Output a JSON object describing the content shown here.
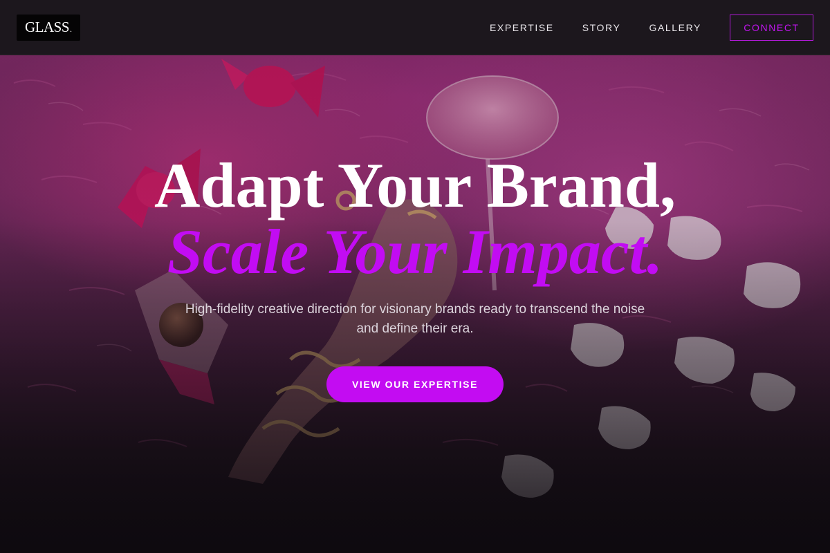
{
  "brand": {
    "logo_text": "GLASS",
    "logo_dot": "."
  },
  "nav": {
    "links": [
      "EXPERTISE",
      "STORY",
      "GALLERY"
    ],
    "cta_label": "CONNECT"
  },
  "hero": {
    "headline_line1": "Adapt Your Brand,",
    "headline_line2": "Scale Your Impact.",
    "subtitle": "High-fidelity creative direction for visionary brands ready to transcend the noise and define their era.",
    "cta_label": "VIEW OUR EXPERTISE"
  },
  "colors": {
    "accent": "#c30cf2",
    "nav_background": "#1c171d",
    "text_primary": "#ffffff",
    "text_secondary": "#dcd4dc"
  }
}
